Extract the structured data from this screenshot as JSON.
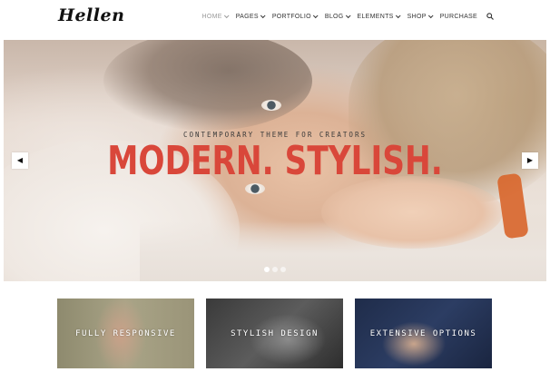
{
  "header": {
    "logo": "Hellen",
    "nav": [
      {
        "label": "HOME",
        "dropdown": true,
        "active": true
      },
      {
        "label": "PAGES",
        "dropdown": true,
        "active": false
      },
      {
        "label": "PORTFOLIO",
        "dropdown": true,
        "active": false
      },
      {
        "label": "BLOG",
        "dropdown": true,
        "active": false
      },
      {
        "label": "ELEMENTS",
        "dropdown": true,
        "active": false
      },
      {
        "label": "SHOP",
        "dropdown": true,
        "active": false
      },
      {
        "label": "PURCHASE",
        "dropdown": false,
        "active": false
      }
    ],
    "search_icon": "search-icon"
  },
  "hero": {
    "subtitle": "CONTEMPORARY THEME FOR CREATORS",
    "title": "MODERN. STYLISH.",
    "title_color": "#d9473a",
    "prev_icon": "chevron-left-icon",
    "next_icon": "chevron-right-icon",
    "prev_glyph": "◀",
    "next_glyph": "▶",
    "slides_total": 3,
    "active_slide": 1
  },
  "features": [
    {
      "label": "FULLY RESPONSIVE"
    },
    {
      "label": "STYLISH DESIGN"
    },
    {
      "label": "EXTENSIVE OPTIONS"
    }
  ]
}
